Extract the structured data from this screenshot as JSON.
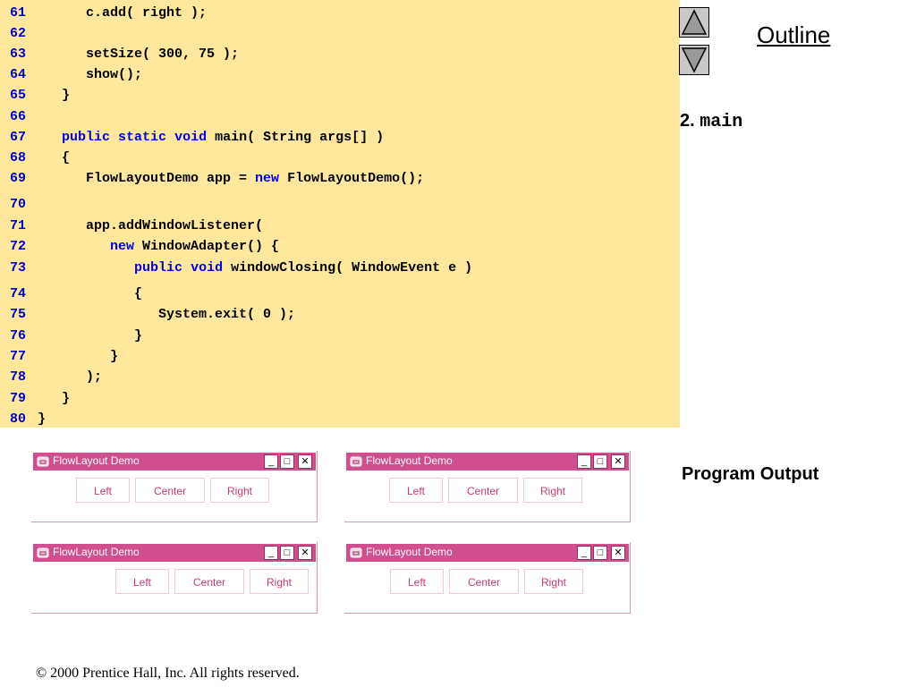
{
  "code": {
    "lines": [
      {
        "num": "61",
        "code": "      c.add( right );"
      },
      {
        "num": "62",
        "code": ""
      },
      {
        "num": "63",
        "code": "      setSize( 300, 75 );"
      },
      {
        "num": "64",
        "code": "      show();"
      },
      {
        "num": "65",
        "code": "   }"
      },
      {
        "num": "66",
        "code": ""
      },
      {
        "num": "67",
        "code": "   public static void main( String args[] )"
      },
      {
        "num": "68",
        "code": "   {"
      },
      {
        "num": "69",
        "code": "      FlowLayoutDemo app = new FlowLayoutDemo();"
      },
      {
        "num": "70",
        "code": ""
      },
      {
        "num": "71",
        "code": "      app.addWindowListener("
      },
      {
        "num": "72",
        "code": "         new WindowAdapter() {"
      },
      {
        "num": "73",
        "code": "            public void windowClosing( WindowEvent e )"
      },
      {
        "num": "74",
        "code": "            {"
      },
      {
        "num": "75",
        "code": "               System.exit( 0 );"
      },
      {
        "num": "76",
        "code": "            }"
      },
      {
        "num": "77",
        "code": "         }"
      },
      {
        "num": "78",
        "code": "      );"
      },
      {
        "num": "79",
        "code": "   }"
      },
      {
        "num": "80",
        "code": "}"
      }
    ],
    "keywords": [
      "public",
      "static",
      "void",
      "new"
    ]
  },
  "sidebar": {
    "outline_label": "Outline",
    "section_number": "2.",
    "section_name": "main",
    "program_output": "Program Output"
  },
  "windows": [
    {
      "title": "FlowLayout Demo",
      "buttons": [
        "Left",
        "Center",
        "Right"
      ],
      "alignment": "left"
    },
    {
      "title": "FlowLayout Demo",
      "buttons": [
        "Left",
        "Center",
        "Right"
      ],
      "alignment": "left"
    },
    {
      "title": "FlowLayout Demo",
      "buttons": [
        "Left",
        "Center",
        "Right"
      ],
      "alignment": "right"
    },
    {
      "title": "FlowLayout Demo",
      "buttons": [
        "Left",
        "Center",
        "Right"
      ],
      "alignment": "center"
    }
  ],
  "footer": "© 2000 Prentice Hall, Inc.  All rights reserved.",
  "colors": {
    "code_background": "#ffe79c",
    "line_number": "#0000cc",
    "keyword": "#0000ee",
    "titlebar": "#d24f8f",
    "button_text": "#c23a78"
  },
  "icons": {
    "up": "triangle-up-icon",
    "down": "triangle-down-icon",
    "window": "java-cup-icon"
  }
}
